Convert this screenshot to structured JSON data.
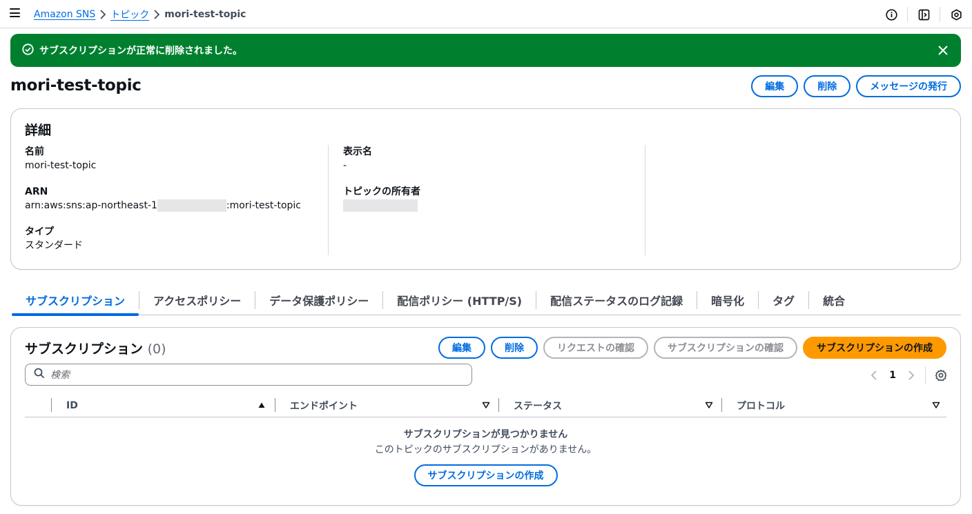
{
  "breadcrumbs": {
    "service": "Amazon SNS",
    "section": "トピック",
    "current": "mori-test-topic"
  },
  "flash": {
    "message": "サブスクリプションが正常に削除されました。",
    "color": "#00802f"
  },
  "header": {
    "title": "mori-test-topic",
    "edit": "編集",
    "delete": "削除",
    "publish": "メッセージの発行"
  },
  "details": {
    "title": "詳細",
    "name_label": "名前",
    "name_value": "mori-test-topic",
    "arn_label": "ARN",
    "arn_prefix": "arn:aws:sns:ap-northeast-1",
    "arn_suffix": ":mori-test-topic",
    "type_label": "タイプ",
    "type_value": "スタンダード",
    "display_name_label": "表示名",
    "display_name_value": "-",
    "owner_label": "トピックの所有者"
  },
  "tabs": [
    "サブスクリプション",
    "アクセスポリシー",
    "データ保護ポリシー",
    "配信ポリシー (HTTP/S)",
    "配信ステータスのログ記録",
    "暗号化",
    "タグ",
    "統合"
  ],
  "subscriptions": {
    "title": "サブスクリプション",
    "count": "(0)",
    "edit": "編集",
    "delete": "削除",
    "confirm_request": "リクエストの確認",
    "confirm_subscription": "サブスクリプションの確認",
    "create": "サブスクリプションの作成",
    "search_placeholder": "検索",
    "page": "1",
    "columns": [
      "ID",
      "エンドポイント",
      "ステータス",
      "プロトコル"
    ],
    "empty_title": "サブスクリプションが見つかりません",
    "empty_desc": "このトピックのサブスクリプションがありません。",
    "empty_create": "サブスクリプションの作成"
  },
  "colors": {
    "link": "#006ce0",
    "primary": "#ff9900",
    "success": "#00802f"
  }
}
